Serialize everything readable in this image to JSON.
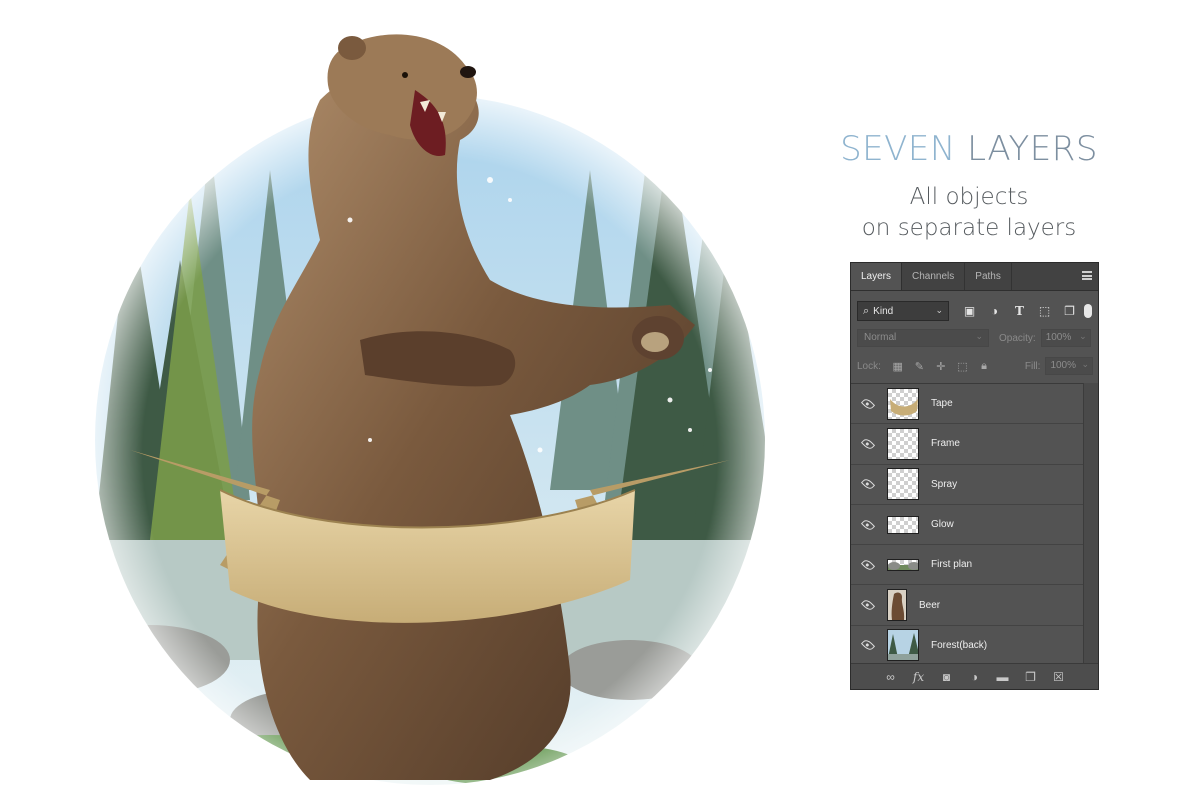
{
  "promo": {
    "title_word1": "SEVEN",
    "title_word2": "LAYERS",
    "subtitle_line1": "All objects",
    "subtitle_line2": "on separate layers"
  },
  "panel": {
    "tabs": [
      "Layers",
      "Channels",
      "Paths"
    ],
    "active_tab": "Layers",
    "filter": {
      "kind_label": "Kind"
    },
    "blend_mode": "Normal",
    "opacity_label": "Opacity:",
    "opacity_value": "100%",
    "lock_label": "Lock:",
    "fill_label": "Fill:",
    "fill_value": "100%",
    "layers": [
      {
        "name": "Tape",
        "visible": true
      },
      {
        "name": "Frame",
        "visible": true
      },
      {
        "name": "Spray",
        "visible": true
      },
      {
        "name": "Glow",
        "visible": true
      },
      {
        "name": "First plan",
        "visible": true
      },
      {
        "name": "Beer",
        "visible": true
      },
      {
        "name": "Forest(back)",
        "visible": true
      }
    ]
  },
  "colors": {
    "panel_bg": "#535353",
    "tab_bar_bg": "#424242",
    "title_accent": "#8fb4cf",
    "title_secondary": "#7d8fa0",
    "subtitle": "#555a5e"
  },
  "icons": {
    "filter": [
      "image-filter-icon",
      "adjustment-filter-icon",
      "type-filter-icon",
      "shape-filter-icon",
      "smart-object-filter-icon"
    ],
    "lock": [
      "lock-pixels-icon",
      "lock-image-icon",
      "lock-position-icon",
      "lock-artboard-icon",
      "lock-all-icon"
    ],
    "footer": [
      "link-layers-icon",
      "fx-icon",
      "add-mask-icon",
      "adjustment-layer-icon",
      "new-group-icon",
      "new-layer-icon",
      "delete-layer-icon"
    ]
  }
}
